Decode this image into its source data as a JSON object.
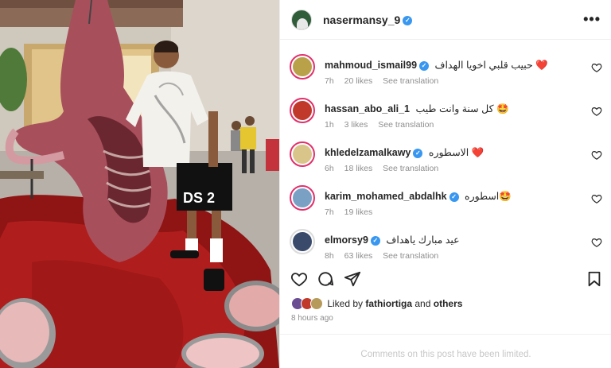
{
  "post": {
    "author": "nasermansy_9",
    "verified": true,
    "more_icon": "more-horizontal-icon",
    "accent_color": "#3897f0"
  },
  "comments": [
    {
      "user": "mahmoud_ismail99",
      "text": "حبيب قلبي اخويا الهداف ❤️",
      "time": "7h",
      "likes": "20 likes",
      "translate": "See translation",
      "verified": true
    },
    {
      "user": "hassan_abo_ali_1",
      "text": "كل سنة وانت طيب 🤩",
      "time": "1h",
      "likes": "3 likes",
      "translate": "See translation",
      "verified": false
    },
    {
      "user": "khledelzamalkawy",
      "text": "الاسطوره ❤️",
      "time": "6h",
      "likes": "18 likes",
      "translate": "See translation",
      "verified": true
    },
    {
      "user": "karim_mohamed_abdalhk",
      "text": "اسطوره🤩",
      "time": "7h",
      "likes": "19 likes",
      "translate": "",
      "verified": true
    },
    {
      "user": "elmorsy9",
      "text": "عيد مبارك ياهداف",
      "time": "8h",
      "likes": "63 likes",
      "translate": "See translation",
      "verified": true
    }
  ],
  "actions": {
    "like": "heart-icon",
    "comment": "comment-icon",
    "share": "send-icon",
    "save": "bookmark-icon"
  },
  "liked_by": {
    "prefix": "Liked by ",
    "user": "fathiortiga",
    "middle": " and ",
    "others": "others"
  },
  "time_ago": "8 hours ago",
  "footer": {
    "limited_text": "Comments on this post have been limited."
  }
}
